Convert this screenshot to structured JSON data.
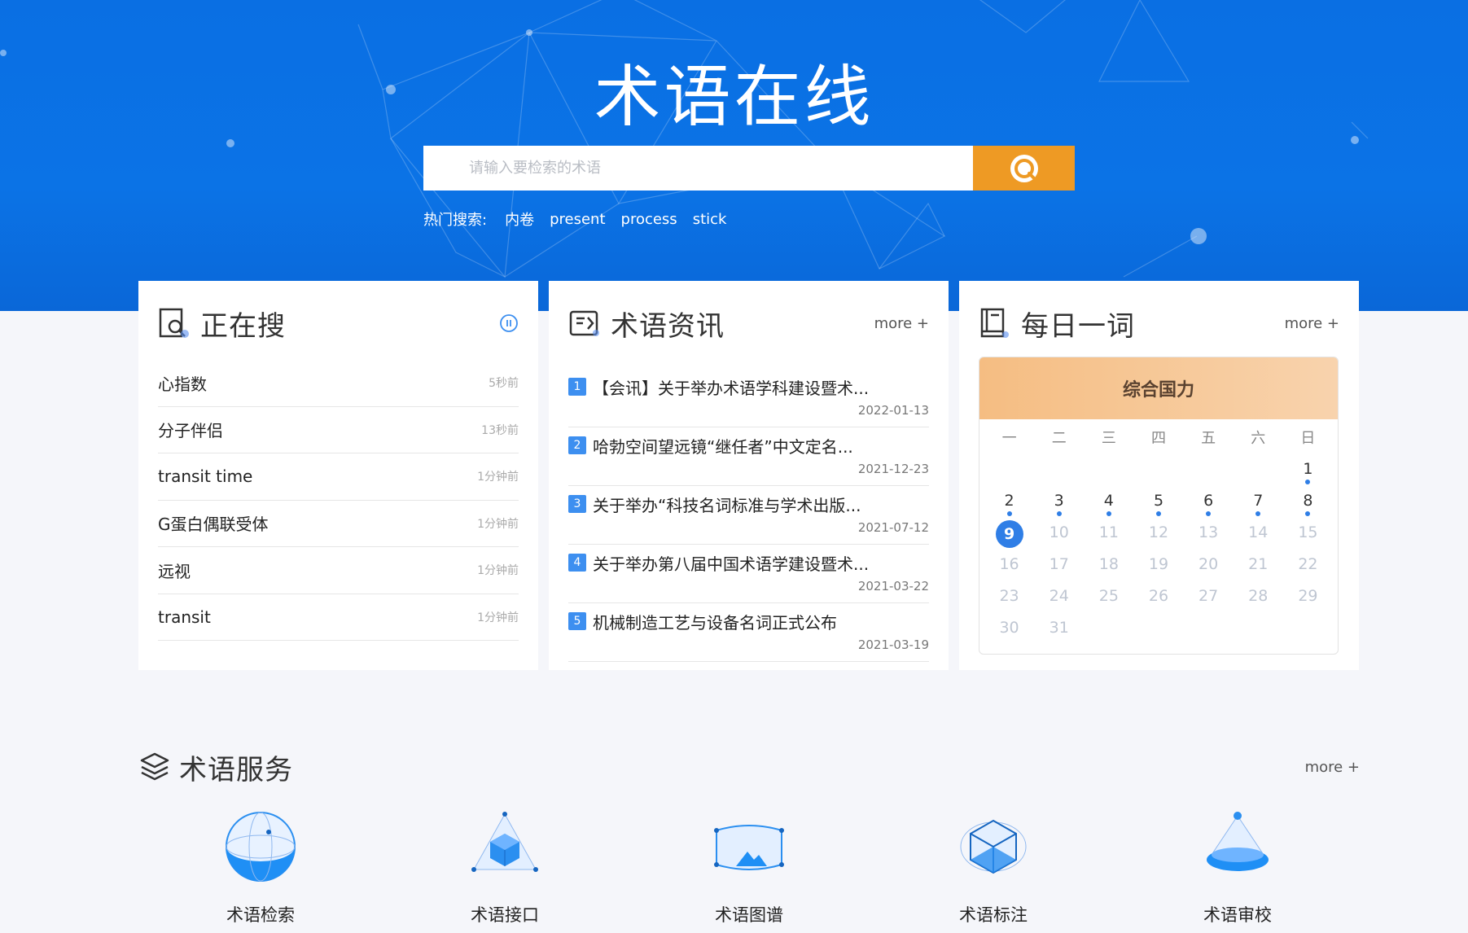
{
  "header": {
    "logo": "术语在线",
    "search_placeholder": "请输入要检索的术语",
    "hot_label": "热门搜索:",
    "hot_terms": [
      "内卷",
      "present",
      "process",
      "stick"
    ]
  },
  "searching": {
    "title": "正在搜",
    "items": [
      {
        "term": "心指数",
        "time": "5秒前"
      },
      {
        "term": "分子伴侣",
        "time": "13秒前"
      },
      {
        "term": "transit time",
        "time": "1分钟前"
      },
      {
        "term": "G蛋白偶联受体",
        "time": "1分钟前"
      },
      {
        "term": "远视",
        "time": "1分钟前"
      },
      {
        "term": "transit",
        "time": "1分钟前"
      }
    ]
  },
  "news": {
    "title": "术语资讯",
    "more": "more +",
    "items": [
      {
        "num": "1",
        "title": "【会讯】关于举办术语学科建设暨术...",
        "date": "2022-01-13"
      },
      {
        "num": "2",
        "title": "哈勃空间望远镜“继任者”中文定名...",
        "date": "2021-12-23"
      },
      {
        "num": "3",
        "title": "关于举办“科技名词标准与学术出版...",
        "date": "2021-07-12"
      },
      {
        "num": "4",
        "title": "关于举办第八届中国术语学建设暨术...",
        "date": "2021-03-22"
      },
      {
        "num": "5",
        "title": "机械制造工艺与设备名词正式公布",
        "date": "2021-03-19"
      }
    ]
  },
  "daily": {
    "title": "每日一词",
    "more": "more +",
    "word": "综合国力",
    "weekdays": [
      "一",
      "二",
      "三",
      "四",
      "五",
      "六",
      "日"
    ],
    "rows": [
      [
        "",
        "",
        "",
        "",
        "",
        "",
        "1"
      ],
      [
        "2",
        "3",
        "4",
        "5",
        "6",
        "7",
        "8"
      ],
      [
        "9",
        "10",
        "11",
        "12",
        "13",
        "14",
        "15"
      ],
      [
        "16",
        "17",
        "18",
        "19",
        "20",
        "21",
        "22"
      ],
      [
        "23",
        "24",
        "25",
        "26",
        "27",
        "28",
        "29"
      ],
      [
        "30",
        "31",
        "",
        "",
        "",
        "",
        ""
      ]
    ],
    "today": "9"
  },
  "services": {
    "title": "术语服务",
    "more": "more +",
    "items": [
      {
        "label": "术语检索",
        "icon": "globe-search-icon"
      },
      {
        "label": "术语接口",
        "icon": "cube-api-icon"
      },
      {
        "label": "术语图谱",
        "icon": "image-map-icon"
      },
      {
        "label": "术语标注",
        "icon": "cube-annotate-icon"
      },
      {
        "label": "术语审校",
        "icon": "cone-review-icon"
      }
    ]
  },
  "colors": {
    "brand_blue": "#0a6fe3",
    "search_orange": "#ee9a24",
    "accent_blue": "#2f7ee6"
  }
}
